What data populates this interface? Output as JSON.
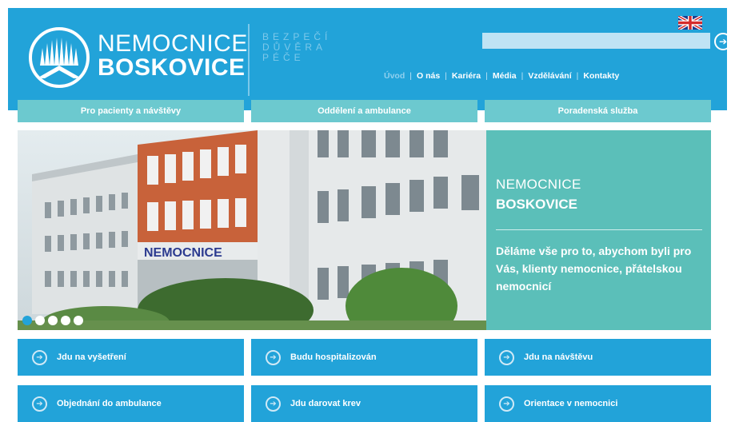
{
  "brand": {
    "line1": "NEMOCNICE",
    "line2": "BOSKOVICE",
    "motto": [
      "BEZPEČÍ",
      "DŮVĚRA",
      "PÉČE"
    ]
  },
  "search": {
    "value": "",
    "placeholder": "",
    "button_icon": "arrow-right-circle-icon"
  },
  "language": {
    "flag_icon": "uk-flag-icon"
  },
  "topnav": {
    "items": [
      {
        "label": "Úvod",
        "active": true
      },
      {
        "label": "O nás"
      },
      {
        "label": "Kariéra"
      },
      {
        "label": "Média"
      },
      {
        "label": "Vzdělávání"
      },
      {
        "label": "Kontakty"
      }
    ]
  },
  "tabs": [
    {
      "label": "Pro pacienty a návštěvy"
    },
    {
      "label": "Oddělení a ambulance"
    },
    {
      "label": "Poradenská služba"
    }
  ],
  "hero": {
    "building_sign": "NEMOCNICE",
    "panel_title1": "NEMOCNICE",
    "panel_title2": "BOSKOVICE",
    "panel_text": "Děláme vše pro to, abychom byli pro Vás, klienty nemocnice, přátelskou nemocnicí",
    "slide_count": 5,
    "active_slide": 1
  },
  "actions": [
    {
      "label": "Jdu na vyšetření"
    },
    {
      "label": "Budu hospitalizován"
    },
    {
      "label": "Jdu na návštěvu"
    },
    {
      "label": "Objednání do ambulance"
    },
    {
      "label": "Jdu darovat krev"
    },
    {
      "label": "Orientace v nemocnici"
    }
  ],
  "colors": {
    "primary": "#22a3d9",
    "teal": "#6cc9cf",
    "panel": "#5bbfb9"
  }
}
